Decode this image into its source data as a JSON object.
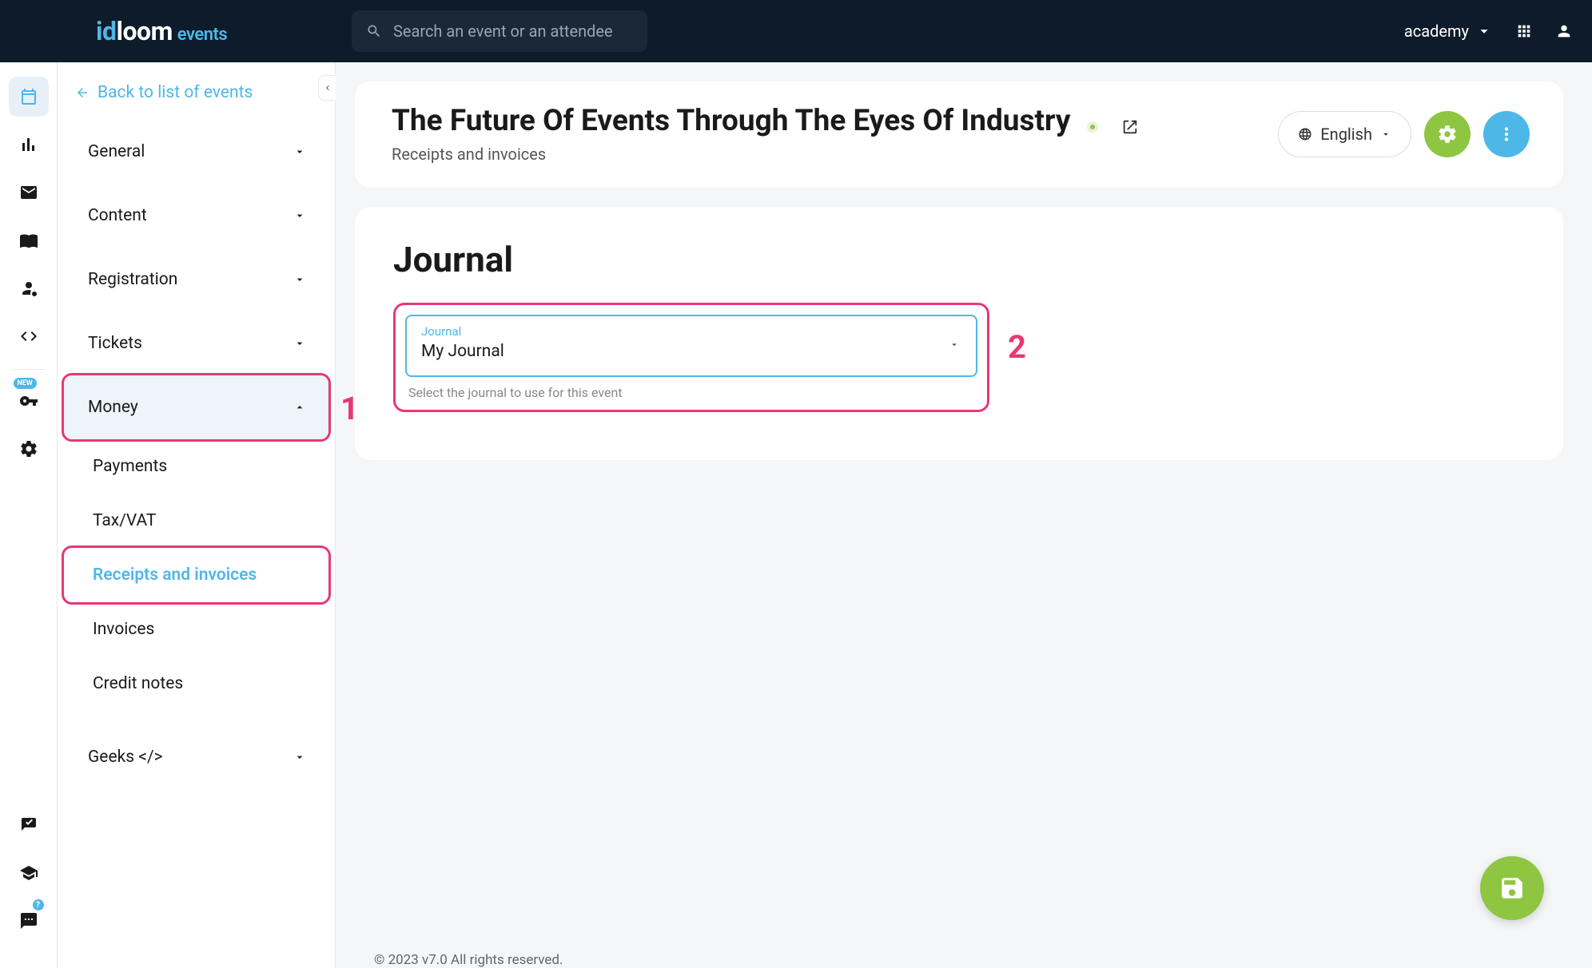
{
  "brand": {
    "part1": "id",
    "part2": "loom",
    "part3": "events"
  },
  "search": {
    "placeholder": "Search an event or an attendee"
  },
  "header_right": {
    "label": "academy"
  },
  "sidebar": {
    "back_label": "Back to list of events",
    "items": {
      "general": "General",
      "content": "Content",
      "registration": "Registration",
      "tickets": "Tickets",
      "money": "Money",
      "geeks": "Geeks </>"
    },
    "sub_items": {
      "payments": "Payments",
      "tax": "Tax/VAT",
      "receipts": "Receipts and invoices",
      "invoices": "Invoices",
      "credit_notes": "Credit notes"
    }
  },
  "annotations": {
    "one": "1",
    "two": "2"
  },
  "rail": {
    "new_badge": "NEW",
    "help_badge": "?"
  },
  "page": {
    "event_title": "The Future Of Events Through The Eyes Of Industry",
    "breadcrumb": "Receipts and invoices",
    "language": "English",
    "section_title": "Journal",
    "select_label": "Journal",
    "select_value": "My Journal",
    "helper": "Select the journal to use for this event"
  },
  "footer": "© 2023 v7.0 All rights reserved."
}
